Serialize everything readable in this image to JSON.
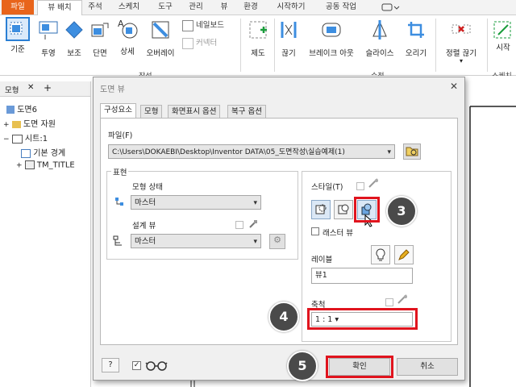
{
  "ribbon": {
    "tabs": [
      "파일",
      "뷰 배치",
      "주석",
      "스케치",
      "도구",
      "관리",
      "뷰",
      "환경",
      "시작하기",
      "공동 작업"
    ],
    "buttons": {
      "base": "기준",
      "projected": "투영",
      "auxiliary": "보조",
      "section": "단면",
      "detail": "상세",
      "overlay": "오버레이",
      "nailboard": "네일보드",
      "connector": "커넥터",
      "draft": "제도",
      "break": "끊기",
      "break_out": "브레이크 아웃",
      "slice": "슬라이스",
      "crop": "오리기",
      "align": "정렬 끊기",
      "start_sketch_1": "스케치",
      "start_sketch_2": "시작"
    },
    "groups": {
      "create": "작성",
      "modify": "수정",
      "sketch": "스케치"
    }
  },
  "browser": {
    "title": "모형",
    "add": "+",
    "close": "✕",
    "items": [
      "도면6",
      "도면 자원",
      "시트:1",
      "기본 경계",
      "TM_TITLE"
    ],
    "expanders": [
      "+",
      "−",
      "+"
    ]
  },
  "dialog": {
    "title": "도면 뷰",
    "close": "✕",
    "tabs": [
      "구성요소",
      "모형",
      "화면표시 옵션",
      "복구 옵션"
    ],
    "file_label": "파일(F)",
    "file_path": "C:\\Users\\DOKAEBI\\Desktop\\Inventor DATA\\05_도면작성\\실습예제(1)",
    "representation_label": "표현",
    "model_state_label": "모형 상태",
    "model_state_value": "마스터",
    "design_view_label": "설계 뷰",
    "design_view_value": "마스터",
    "style_label": "스타일(T)",
    "raster_view_label": "래스터 뷰",
    "label_label": "레이블",
    "label_value": "뷰1",
    "scale_label": "축척",
    "scale_value": "1 : 1",
    "ok": "확인",
    "cancel": "취소",
    "help": "?"
  },
  "steps": [
    "3",
    "4",
    "5"
  ],
  "colors": {
    "file_tab": "#e8641b",
    "highlight": "#e0141e",
    "step_badge": "#4a4a4a"
  }
}
